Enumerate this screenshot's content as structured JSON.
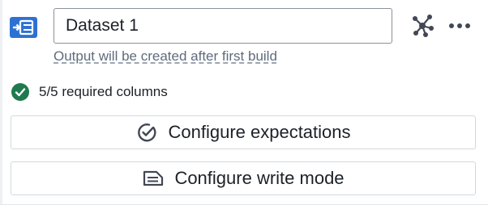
{
  "header": {
    "dataset_icon": "dataset-output-icon",
    "dataset_name": "Dataset 1",
    "graph_icon": "graph-nodes-icon",
    "more_icon": "more-options-icon"
  },
  "output_note": "Output will be created after first build",
  "status": {
    "icon": "check-circle-icon",
    "text": "5/5 required columns",
    "color": "#1f7a4d"
  },
  "actions": {
    "expectations": {
      "icon": "expectations-check-icon",
      "label": "Configure expectations"
    },
    "write_mode": {
      "icon": "write-mode-icon",
      "label": "Configure write mode"
    }
  },
  "colors": {
    "accent": "#2d72d2",
    "text": "#1c2127",
    "muted": "#5f6b7c",
    "success": "#1f7a4d"
  }
}
